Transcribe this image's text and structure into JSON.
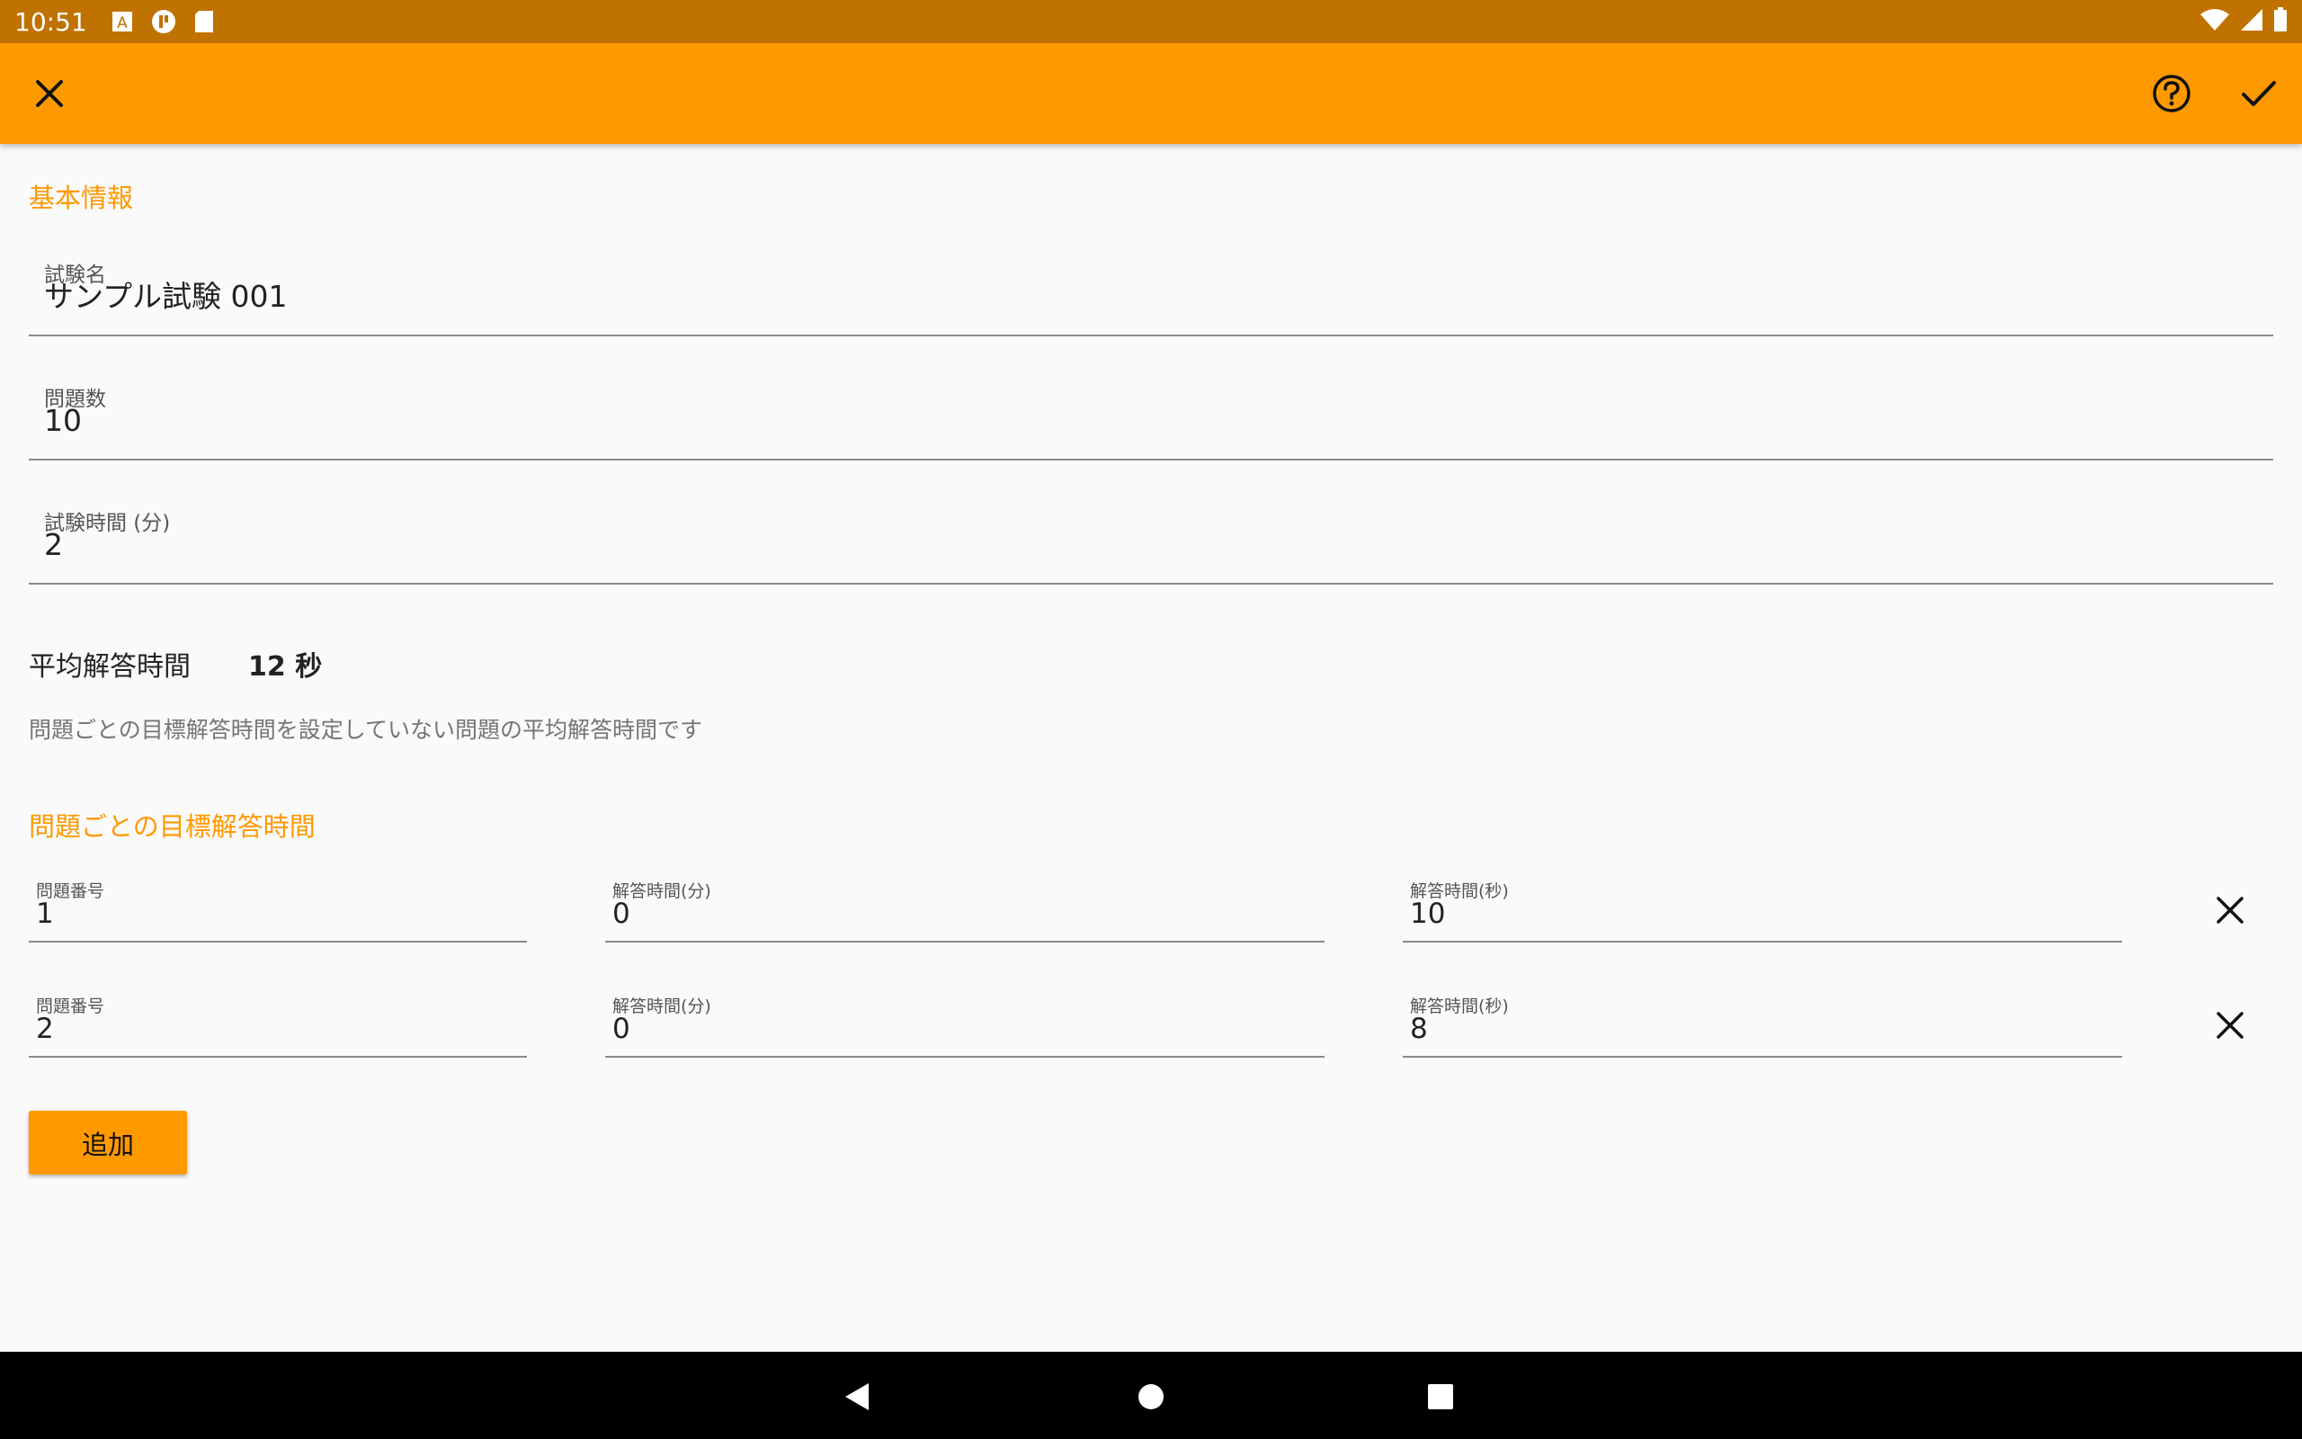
{
  "status_bar": {
    "time": "10:51",
    "icons": [
      "notification-a-icon",
      "app-icon",
      "sd-card-icon"
    ],
    "right_icons": [
      "wifi-icon",
      "signal-icon",
      "battery-icon"
    ]
  },
  "app_bar": {
    "close_icon": "close-icon",
    "help_icon": "help-icon",
    "confirm_icon": "check-icon",
    "accent_color": "#ff9900"
  },
  "basic_info": {
    "title": "基本情報",
    "fields": [
      {
        "label": "試験名",
        "value": "サンプル試験 001"
      },
      {
        "label": "問題数",
        "value": "10"
      },
      {
        "label": "試験時間 (分)",
        "value": "2"
      }
    ]
  },
  "average": {
    "label": "平均解答時間",
    "value": "12 秒",
    "note": "問題ごとの目標解答時間を設定していない問題の平均解答時間です"
  },
  "per_question": {
    "title": "問題ごとの目標解答時間",
    "rows": [
      {
        "number_label": "問題番号",
        "number": "1",
        "min_label": "解答時間(分)",
        "min": "0",
        "sec_label": "解答時間(秒)",
        "sec": "10"
      },
      {
        "number_label": "問題番号",
        "number": "2",
        "min_label": "解答時間(分)",
        "min": "0",
        "sec_label": "解答時間(秒)",
        "sec": "8"
      }
    ],
    "add_label": "追加"
  },
  "nav_bar": {
    "icons": [
      "back-icon",
      "home-icon",
      "recents-icon"
    ]
  }
}
